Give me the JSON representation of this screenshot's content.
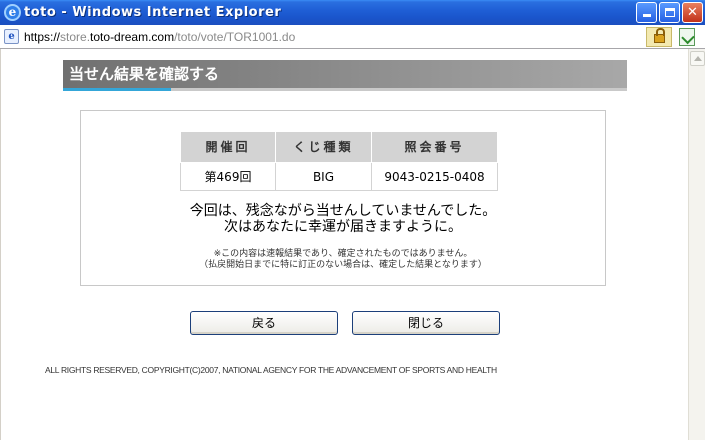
{
  "window": {
    "title": "toto - Windows Internet Explorer",
    "minimize_label": "",
    "maximize_label": "",
    "close_label": "✕"
  },
  "address": {
    "scheme": "https://",
    "host_prefix": "store.",
    "host": "toto-dream.com",
    "path": "/toto/vote/TOR1001.do"
  },
  "page": {
    "heading": "当せん結果を確認する",
    "table": {
      "headers": [
        "開催回",
        "くじ種類",
        "照会番号"
      ],
      "row": [
        "第469回",
        "BIG",
        "9043-0215-0408"
      ]
    },
    "message_line1": "今回は、残念ながら当せんしていませんでした。",
    "message_line2": "次はあなたに幸運が届きますように。",
    "note_line1": "※この内容は速報結果であり、確定されたものではありません。",
    "note_line2": "（払戻開始日までに特に訂正のない場合は、確定した結果となります）",
    "back_button": "戻る",
    "close_button": "閉じる",
    "copyright": "ALL RIGHTS RESERVED, COPYRIGHT(C)2007, NATIONAL AGENCY FOR THE ADVANCEMENT OF SPORTS AND HEALTH"
  },
  "colors": {
    "header_accent": "#34a6d8",
    "header_gray": "#707070",
    "title_bar_blue": "#1f5fd6"
  }
}
